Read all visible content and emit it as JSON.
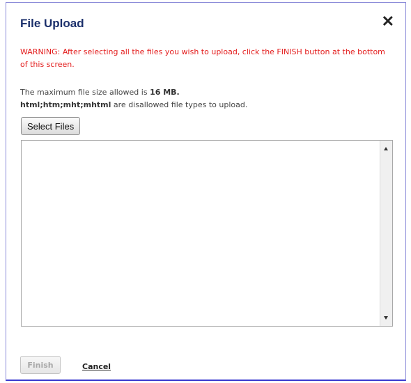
{
  "dialog": {
    "title": "File Upload",
    "close_glyph": "✕",
    "warning": "WARNING: After selecting all the files you wish to upload, click the FINISH button at the bottom of this screen.",
    "max_size_prefix": "The maximum file size allowed is ",
    "max_size_value": "16 MB.",
    "disallowed_types": "html;htm;mht;mhtml",
    "disallowed_suffix": " are disallowed file types to upload.",
    "select_files_label": "Select Files",
    "finish_label": "Finish",
    "finish_enabled": false,
    "cancel_label": "Cancel"
  },
  "colors": {
    "title": "#1b2f6b",
    "warning": "#e31b1b",
    "dialog_border": "#3b3bcf"
  },
  "icons": {
    "close": "close-icon",
    "scroll_up": "arrow-up-icon",
    "scroll_down": "arrow-down-icon"
  }
}
